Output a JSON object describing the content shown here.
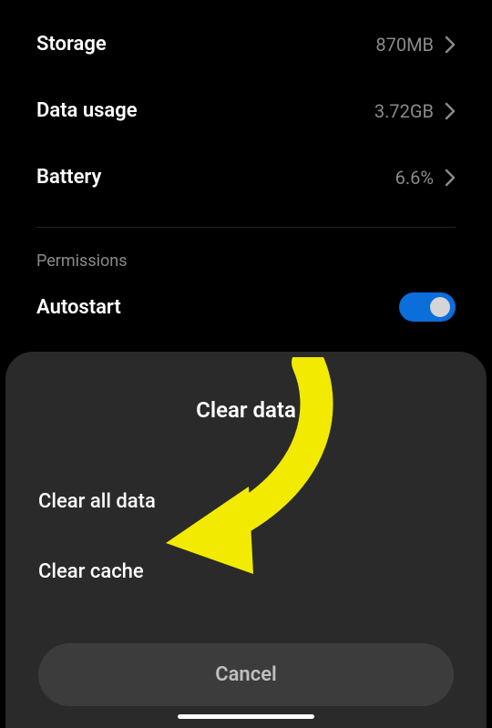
{
  "settings": {
    "storage": {
      "label": "Storage",
      "value": "870MB"
    },
    "data_usage": {
      "label": "Data usage",
      "value": "3.72GB"
    },
    "battery": {
      "label": "Battery",
      "value": "6.6%"
    }
  },
  "permissions": {
    "header": "Permissions",
    "autostart": {
      "label": "Autostart",
      "enabled": true
    }
  },
  "sheet": {
    "title": "Clear data",
    "clear_all": "Clear all data",
    "clear_cache": "Clear cache",
    "cancel": "Cancel"
  }
}
